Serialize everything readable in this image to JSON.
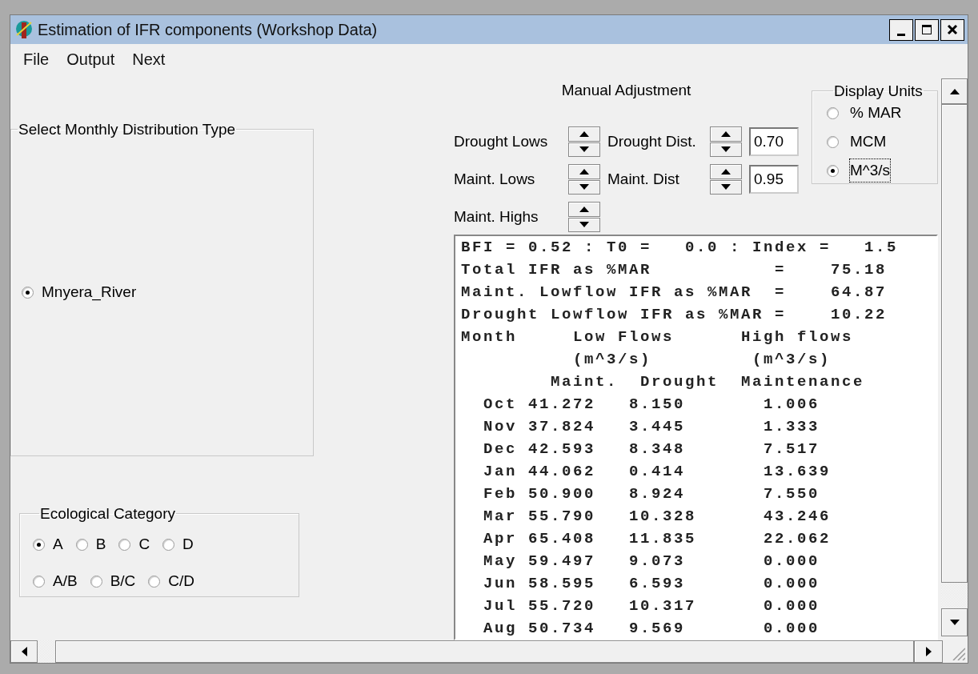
{
  "window": {
    "title": "Estimation of IFR components (Workshop Data)"
  },
  "menu": [
    "File",
    "Output",
    "Next"
  ],
  "distribution_group": {
    "title": "Select Monthly Distribution Type",
    "options": [
      {
        "label": "Mnyera_River",
        "selected": true
      }
    ]
  },
  "ecological_category": {
    "title": "Ecological Category",
    "rows": [
      {
        "options": [
          {
            "label": "A",
            "selected": true
          },
          {
            "label": "B",
            "selected": false
          },
          {
            "label": "C",
            "selected": false
          },
          {
            "label": "D",
            "selected": false
          }
        ]
      },
      {
        "options": [
          {
            "label": "A/B",
            "selected": false
          },
          {
            "label": "B/C",
            "selected": false
          },
          {
            "label": "C/D",
            "selected": false
          }
        ]
      }
    ]
  },
  "manual_adjustment": {
    "title": "Manual Adjustment",
    "rows": [
      {
        "controls": [
          {
            "label": "Drought Lows"
          },
          {
            "label": "Drought Dist.",
            "value": "0.70"
          }
        ]
      },
      {
        "controls": [
          {
            "label": "Maint. Lows"
          },
          {
            "label": "Maint. Dist",
            "value": "0.95"
          }
        ]
      },
      {
        "controls": [
          {
            "label": "Maint. Highs"
          }
        ]
      }
    ]
  },
  "display_units": {
    "title": "Display Units",
    "options": [
      {
        "label": "% MAR",
        "selected": false,
        "focused": false
      },
      {
        "label": "MCM",
        "selected": false,
        "focused": false
      },
      {
        "label": "M^3/s",
        "selected": true,
        "focused": true
      }
    ]
  },
  "output": {
    "summary": [
      "BFI = 0.52 : T0 =   0.0 : Index =   1.5",
      "Total IFR as %MAR           =    75.18",
      "Maint. Lowflow IFR as %MAR  =    64.87",
      "Drought Lowflow IFR as %MAR =    10.22"
    ],
    "group_headers": [
      "Month",
      "Low Flows",
      "High flows"
    ],
    "units": [
      "(m^3/s)",
      "(m^3/s)"
    ],
    "column_headers": [
      "Maint.",
      "Drought",
      "Maintenance"
    ],
    "rows": [
      {
        "month": "Oct",
        "maint": "41.272",
        "drought": "8.150",
        "maintenance": "1.006"
      },
      {
        "month": "Nov",
        "maint": "37.824",
        "drought": "3.445",
        "maintenance": "1.333"
      },
      {
        "month": "Dec",
        "maint": "42.593",
        "drought": "8.348",
        "maintenance": "7.517"
      },
      {
        "month": "Jan",
        "maint": "44.062",
        "drought": "0.414",
        "maintenance": "13.639"
      },
      {
        "month": "Feb",
        "maint": "50.900",
        "drought": "8.924",
        "maintenance": "7.550"
      },
      {
        "month": "Mar",
        "maint": "55.790",
        "drought": "10.328",
        "maintenance": "43.246"
      },
      {
        "month": "Apr",
        "maint": "65.408",
        "drought": "11.835",
        "maintenance": "22.062"
      },
      {
        "month": "May",
        "maint": "59.497",
        "drought": "9.073",
        "maintenance": "0.000"
      },
      {
        "month": "Jun",
        "maint": "58.595",
        "drought": "6.593",
        "maintenance": "0.000"
      },
      {
        "month": "Jul",
        "maint": "55.720",
        "drought": "10.317",
        "maintenance": "0.000"
      },
      {
        "month": "Aug",
        "maint": "50.734",
        "drought": "9.569",
        "maintenance": "0.000"
      }
    ]
  }
}
